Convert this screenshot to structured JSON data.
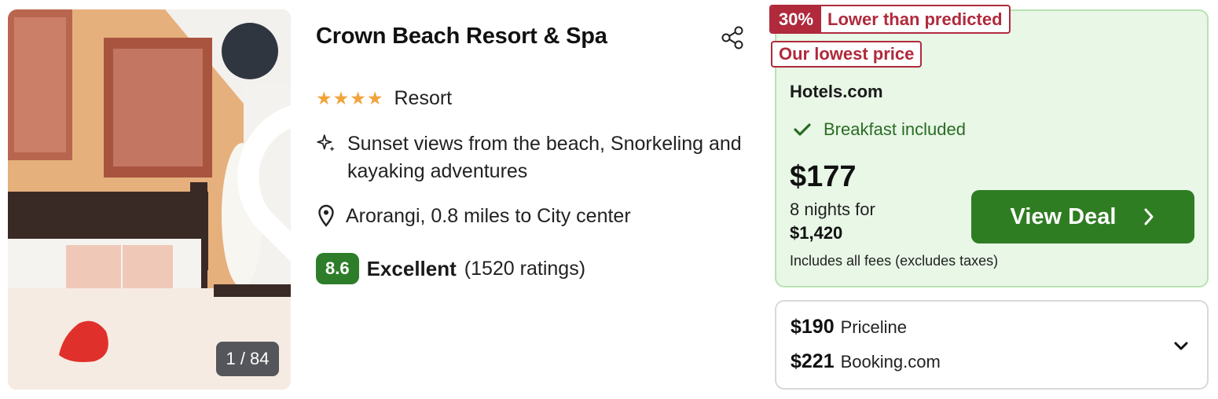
{
  "photo": {
    "counter": "1 / 84"
  },
  "hotel": {
    "name": "Crown Beach Resort & Spa",
    "stars": 4,
    "type": "Resort",
    "highlights": "Sunset views from the beach, Snorkeling and kayaking adventures",
    "location": "Arorangi, 0.8 miles to City center",
    "score": "8.6",
    "rating_word": "Excellent",
    "rating_count": "(1520 ratings)"
  },
  "deal": {
    "badge_percent": "30%",
    "badge_text": "Lower than predicted",
    "badge_lowest": "Our lowest price",
    "provider": "Hotels.com",
    "amenity": "Breakfast included",
    "price": "$177",
    "nights": "8 nights for",
    "total": "$1,420",
    "fees": "Includes all fees (excludes taxes)",
    "button_label": "View Deal"
  },
  "other_offers": [
    {
      "price": "$190",
      "provider": "Priceline"
    },
    {
      "price": "$221",
      "provider": "Booking.com"
    }
  ],
  "colors": {
    "star": "#f2a33a",
    "score_bg": "#2e7d2a",
    "deal_bg": "#e8f7e6",
    "badge": "#b02a3c",
    "button": "#2f7d22"
  }
}
